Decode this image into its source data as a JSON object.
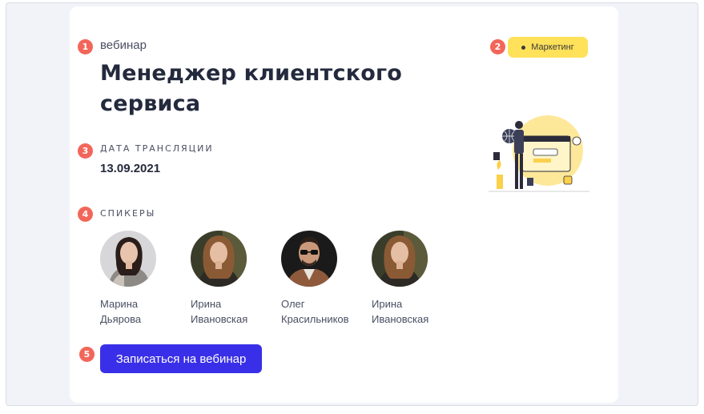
{
  "webinar": {
    "kicker": "вебинар",
    "title": "Менеджер клиентского сервиса",
    "tag": "Маркетинг",
    "broadcast_label": "ДАТА ТРАНСЛЯЦИИ",
    "broadcast_date": "13.09.2021",
    "speakers_label": "СПИКЕРЫ",
    "speakers": [
      {
        "name": "Марина\nДьярова"
      },
      {
        "name": "Ирина\nИвановская"
      },
      {
        "name": "Олег\nКрасильников"
      },
      {
        "name": "Ирина\nИвановская"
      }
    ],
    "cta_label": "Записаться на вебинар"
  },
  "markers": [
    "1",
    "2",
    "3",
    "4",
    "5"
  ],
  "colors": {
    "accent": "#3a2fe8",
    "tag_bg": "#ffe15a",
    "marker": "#f2665a",
    "page_bg": "#f2f3f8"
  },
  "icons": [
    "dot-icon",
    "webinar-illustration"
  ]
}
